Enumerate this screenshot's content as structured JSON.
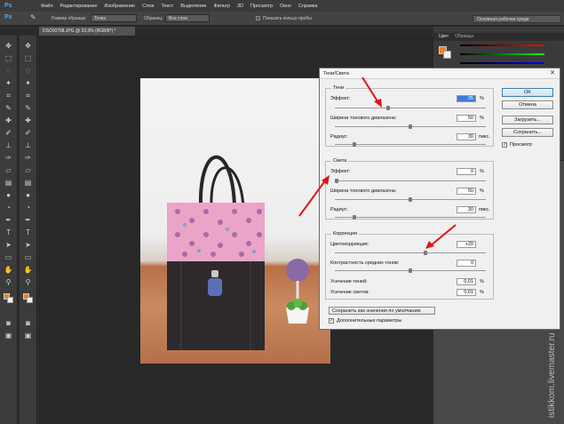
{
  "app": {
    "logo": "Ps",
    "menu": [
      "Файл",
      "Редактирование",
      "Изображение",
      "Слои",
      "Текст",
      "Выделение",
      "Фильтр",
      "3D",
      "Просмотр",
      "Окно",
      "Справка"
    ]
  },
  "options": {
    "sample_size_label": "Размер образца:",
    "sample_size_value": "Точка",
    "samples_label": "Образец:",
    "samples_value": "Все слои",
    "show_ring_label": "Показать кольцо пробы",
    "workspace": "Основная рабочая среда"
  },
  "document": {
    "tab_title": "DSC00708.JPG @ 33,3% (RGB/8*) *"
  },
  "panels": {
    "color_tab": "Цвет",
    "swatches_tab": "Образцы",
    "colors": {
      "fg": "#e8822a",
      "bg": "#f1f1f1"
    }
  },
  "dialog": {
    "title": "Тени/Света",
    "shadows": {
      "group_title": "Тени",
      "amount_label": "Эффект:",
      "amount_value": "35",
      "amount_unit": "%",
      "tonal_width_label": "Ширина тонового диапазона:",
      "tonal_width_value": "50",
      "tonal_width_unit": "%",
      "radius_label": "Радиус:",
      "radius_value": "30",
      "radius_unit": "пикс."
    },
    "highlights": {
      "group_title": "Света",
      "amount_label": "Эффект:",
      "amount_value": "0",
      "amount_unit": "%",
      "tonal_width_label": "Ширина тонового диапазона:",
      "tonal_width_value": "50",
      "tonal_width_unit": "%",
      "radius_label": "Радиус:",
      "radius_value": "30",
      "radius_unit": "пикс."
    },
    "adjustments": {
      "group_title": "Коррекция",
      "color_label": "Цветокоррекция:",
      "color_value": "+20",
      "midtone_label": "Контрастность средних тонов:",
      "midtone_value": "0",
      "black_clip_label": "Усечение теней:",
      "black_clip_value": "0,01",
      "black_clip_unit": "%",
      "white_clip_label": "Усечение светов:",
      "white_clip_value": "0,01",
      "white_clip_unit": "%"
    },
    "buttons": {
      "ok": "OK",
      "cancel": "Отмена",
      "load": "Загрузить...",
      "save": "Сохранить...",
      "preview": "Просмотр",
      "save_defaults": "Сохранить как значения по умолчанию",
      "more_options": "Дополнительные параметры"
    },
    "state": {
      "preview_checked": true,
      "more_options_checked": true,
      "sliders": {
        "shadows_amount": 0.35,
        "shadows_tonal": 0.5,
        "shadows_radius": 0.12,
        "highlights_amount": 0.0,
        "highlights_tonal": 0.5,
        "highlights_radius": 0.12,
        "color_correction": 0.6,
        "midtone": 0.5
      }
    }
  },
  "watermark": "istikkom.livemaster.ru"
}
